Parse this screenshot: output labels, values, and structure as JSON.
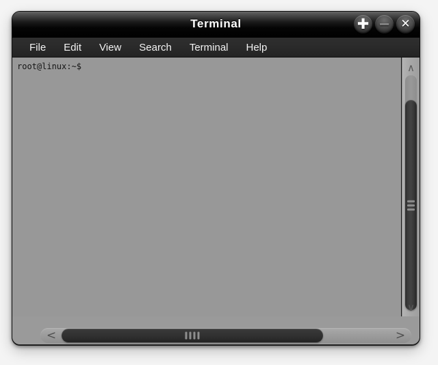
{
  "window": {
    "title": "Terminal",
    "buttons": [
      {
        "name": "maximize",
        "glyph": "✚",
        "label": "Maximize",
        "color": "#ffffff"
      },
      {
        "name": "minimize",
        "glyph": "−",
        "label": "Minimize",
        "color": "#8f8f8f"
      },
      {
        "name": "close",
        "glyph": "✕",
        "label": "Close",
        "color": "#ffffff"
      }
    ]
  },
  "menubar": {
    "items": [
      {
        "label": "File"
      },
      {
        "label": "Edit"
      },
      {
        "label": "View"
      },
      {
        "label": "Search"
      },
      {
        "label": "Terminal"
      },
      {
        "label": "Help"
      }
    ]
  },
  "terminal": {
    "prompt": "root@linux:~$",
    "lines": [
      "root@linux:~$"
    ],
    "background_color": "#989898",
    "text_color": "#141414",
    "user": "root",
    "host": "linux",
    "cwd": "~"
  },
  "scrollbars": {
    "vertical": {
      "up_arrow": "∧",
      "down_arrow": "∨",
      "grip_lines": 3,
      "thumb_position_percent": 12
    },
    "horizontal": {
      "left_arrow": "<",
      "right_arrow": ">",
      "grip_lines": 4,
      "thumb_position_percent": 8
    }
  }
}
